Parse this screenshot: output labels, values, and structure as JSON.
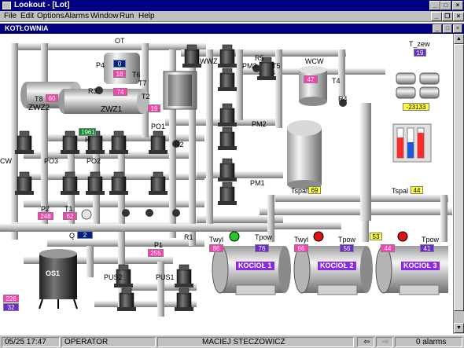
{
  "window": {
    "title": "Lookout - [Lot]"
  },
  "menu": {
    "items": [
      "File",
      "Edit",
      "Options",
      "Alarms",
      "Window",
      "Run",
      "Help"
    ]
  },
  "panel": {
    "title": "KOTŁOWNIA"
  },
  "labels": {
    "ot": "OT",
    "t_zew": "T_zew",
    "p4": "P4",
    "t6": "T6",
    "t7": "T7",
    "t8": "T8",
    "r3": "R3",
    "t2": "T2",
    "zwz2": "ZWZ2",
    "zwz1": "ZWZ1",
    "wwz": "WWZ",
    "pm3": "PM3",
    "r5": "R5",
    "t5": "T5",
    "wcw": "WCW",
    "t4": "T4",
    "r4": "R4",
    "pm2": "PM2",
    "po1": "PO1",
    "r2": "R2",
    "h": "H",
    "cw": "CW",
    "po3": "PO3",
    "po2": "PO2",
    "pm1": "PM1",
    "tspal1": "Tspal",
    "tspal2": "Tspal",
    "p2": "P2",
    "t1": "T1",
    "q": "Q",
    "r1": "R1",
    "p1": "P1",
    "twyl1": "Twyl",
    "tpow1": "Tpow",
    "twyl2": "Twyl",
    "tpow2": "Tpow",
    "tpow3": "Tpow",
    "os1": "OS1",
    "pus2": "PUS2",
    "pus1": "PUS1",
    "kociol1": "KOCIOŁ 1",
    "kociol2": "KOCIOŁ 2",
    "kociol3": "KOCIOŁ 3"
  },
  "values": {
    "t_zew": "19",
    "p4": "0",
    "t6": "18",
    "t7": "74",
    "t8": "60",
    "t2": "19",
    "r3_value": "1961",
    "t5": "47",
    "counter": "-23133",
    "tspal1": "69",
    "tspal2": "44",
    "p2": "248",
    "t1": "62",
    "q": "2",
    "p1": "255",
    "twyl1": "86",
    "tpow1": "76",
    "twyl2": "66",
    "tpow2": "56",
    "boiler3_a": "53",
    "boiler3_b": "44",
    "tpow3": "41",
    "left_a": "226",
    "left_b": "32"
  },
  "status": {
    "datetime": "05/25 17:47",
    "role": "OPERATOR",
    "user": "MACIEJ STECZOWICZ",
    "alarms": "0 alarms"
  },
  "colors": {
    "title_bar": "#000080",
    "pipe": "#c8c8c8",
    "magenta_value": "#ff3fb0",
    "purple_value": "#6a2ccc",
    "yellow_value": "#ffff33",
    "valve_green": "#22cc22",
    "valve_red": "#dd1111"
  }
}
